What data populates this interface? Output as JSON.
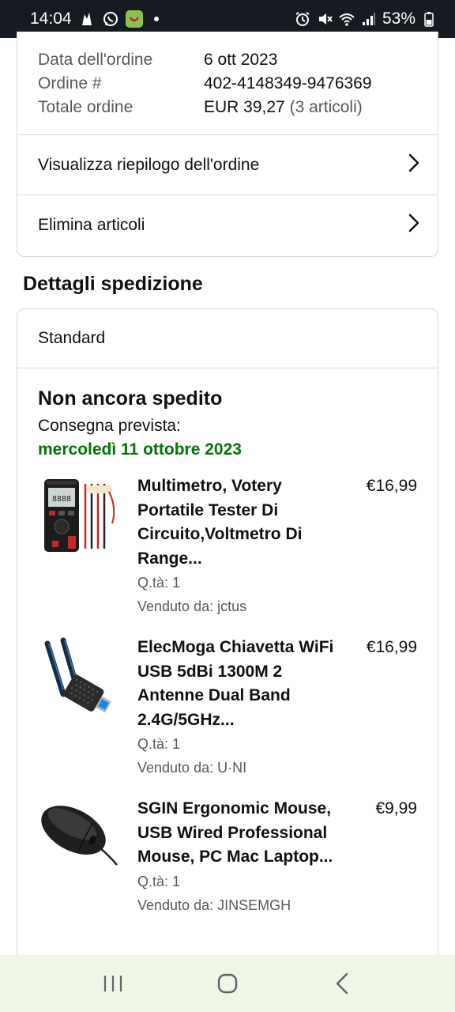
{
  "status_bar": {
    "time": "14:04",
    "battery": "53%",
    "left_icons": [
      "notification-icon",
      "whatsapp-icon",
      "app-icon",
      "dot-icon"
    ],
    "right_icons": [
      "alarm-icon",
      "mute-icon",
      "wifi-icon",
      "signal-icon",
      "battery-icon"
    ]
  },
  "order_summary": {
    "date_label": "Data dell'ordine",
    "date_value": "6 ott 2023",
    "number_label": "Ordine #",
    "number_value": "402-4148349-9476369",
    "total_label": "Totale ordine",
    "total_value": "EUR 39,27",
    "total_items": "(3 articoli)",
    "view_summary_link": "Visualizza riepilogo dell'ordine",
    "delete_items_link": "Elimina articoli"
  },
  "shipping": {
    "section_title": "Dettagli spedizione",
    "method": "Standard",
    "status": "Non ancora spedito",
    "expected_label": "Consegna prevista:",
    "expected_date": "mercoledì 11 ottobre 2023",
    "items": [
      {
        "title": "Multimetro, Votery Portatile Tester Di Circuito,Voltmetro Di Range...",
        "price": "€16,99",
        "qty": "Q.tà: 1",
        "seller": "Venduto da: jctus",
        "icon": "multimeter-image"
      },
      {
        "title": "ElecMoga Chiavetta WiFi USB 5dBi 1300M 2 Antenne Dual Band 2.4G/5GHz...",
        "price": "€16,99",
        "qty": "Q.tà: 1",
        "seller": "Venduto da: U·NI",
        "icon": "wifi-adapter-image"
      },
      {
        "title": "SGIN Ergonomic Mouse, USB Wired Professional Mouse, PC Mac Laptop...",
        "price": "€9,99",
        "qty": "Q.tà: 1",
        "seller": "Venduto da: JINSEMGH",
        "icon": "mouse-image"
      }
    ]
  },
  "nav_bar": {
    "icons": [
      "recent-apps-icon",
      "home-icon",
      "back-icon"
    ]
  }
}
